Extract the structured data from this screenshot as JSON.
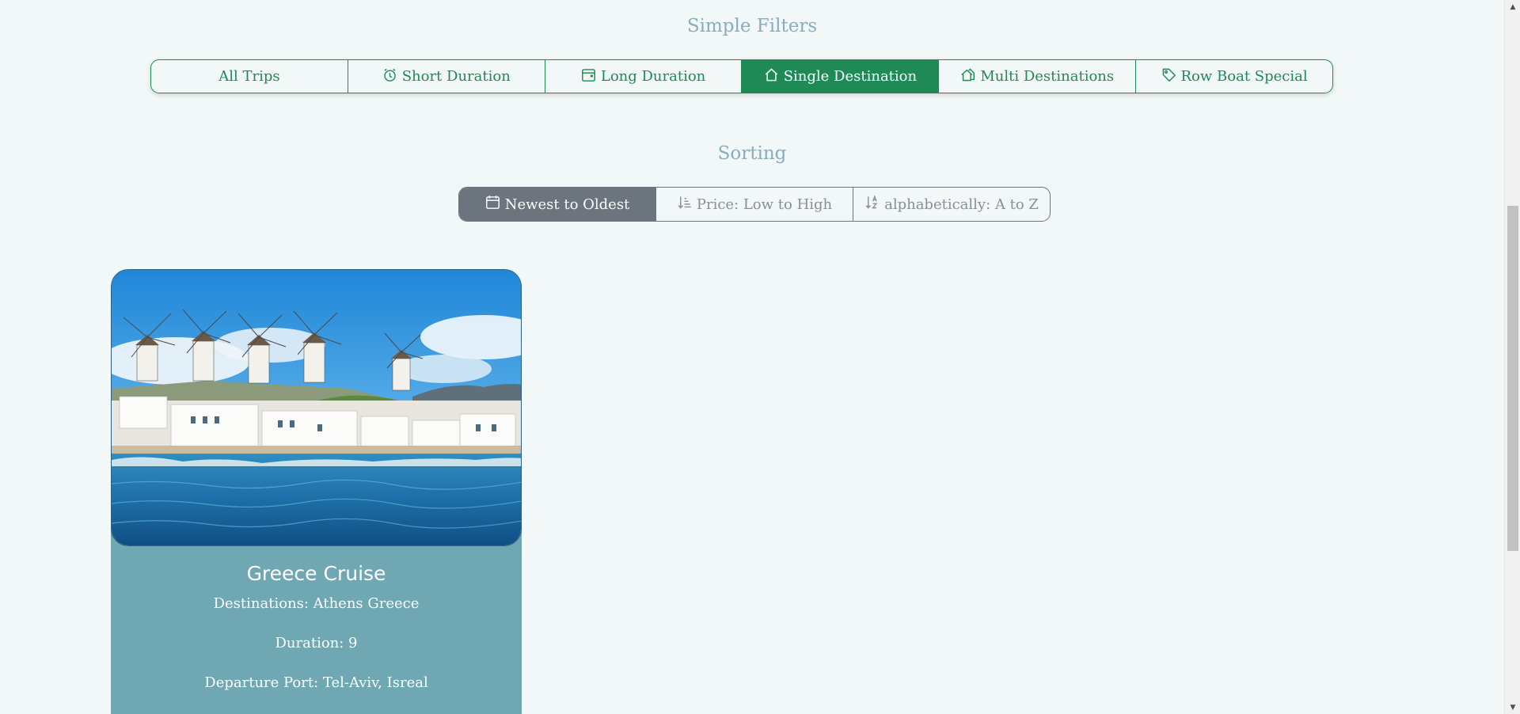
{
  "filters": {
    "title": "Simple Filters",
    "items": [
      {
        "label": "All Trips",
        "icon": "none",
        "active": false
      },
      {
        "label": "Short Duration",
        "icon": "alarm-clock-icon",
        "active": false
      },
      {
        "label": "Long Duration",
        "icon": "calendar-icon",
        "active": false
      },
      {
        "label": "Single Destination",
        "icon": "house-icon",
        "active": true
      },
      {
        "label": "Multi Destinations",
        "icon": "houses-icon",
        "active": false
      },
      {
        "label": "Row Boat Special",
        "icon": "tag-icon",
        "active": false
      }
    ]
  },
  "sorting": {
    "title": "Sorting",
    "items": [
      {
        "label": "Newest to Oldest",
        "icon": "calendar-icon",
        "active": true
      },
      {
        "label": "Price: Low to High",
        "icon": "sort-numeric-down-icon",
        "active": false
      },
      {
        "label": "alphabetically: A to Z",
        "icon": "sort-alpha-down-icon",
        "active": false
      }
    ]
  },
  "card": {
    "image_alt": "Mykonos windmills by the sea",
    "title": "Greece Cruise",
    "destinations": "Destinations: Athens Greece",
    "duration": "Duration: 9",
    "departure_port": "Departure Port: Tel-Aviv, Isreal"
  },
  "colors": {
    "accent_green": "#1f8a55",
    "sort_gray": "#6c757d",
    "card_bg": "#6fa8b2",
    "title_blue": "#86aebf",
    "page_bg": "#f2f7f7"
  }
}
